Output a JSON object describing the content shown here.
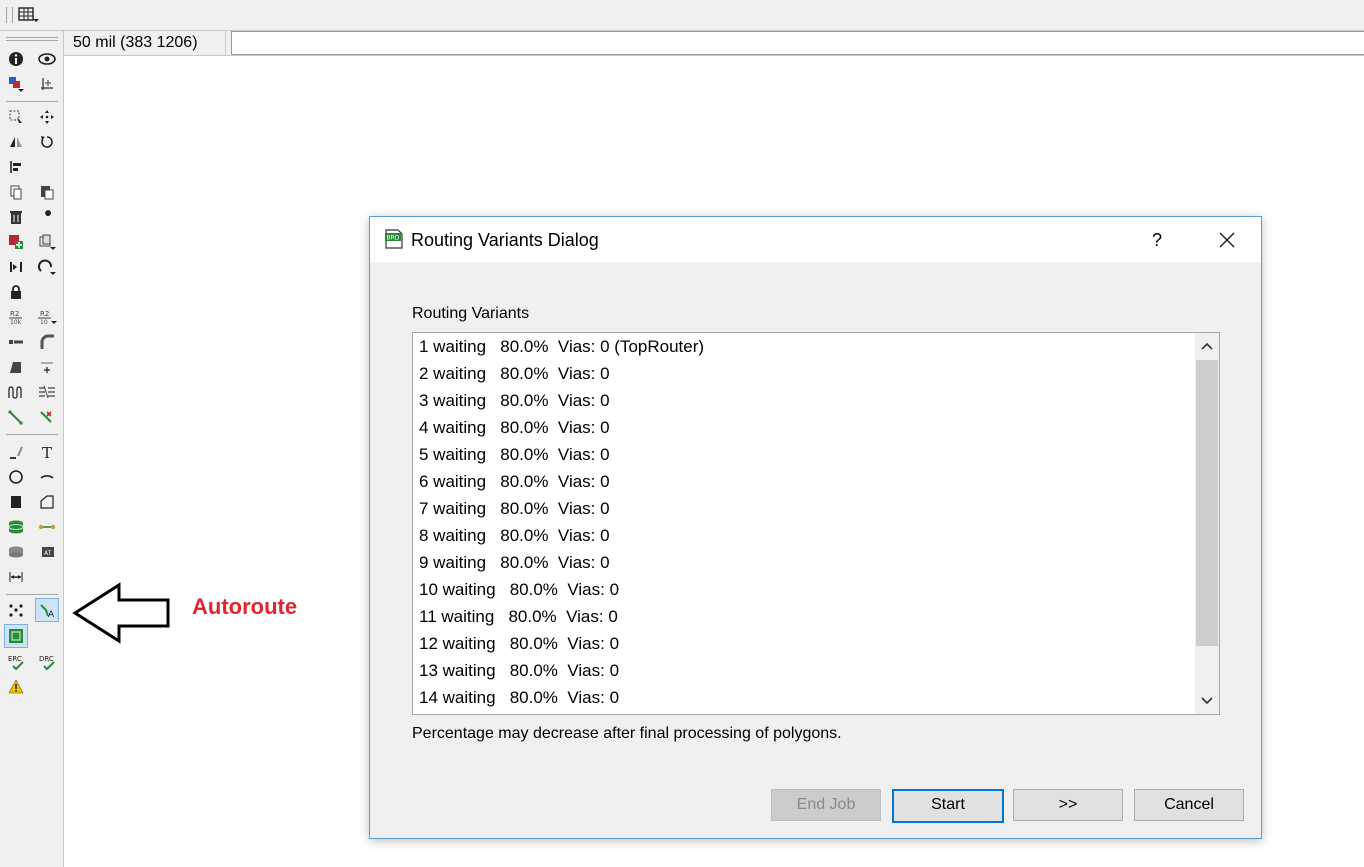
{
  "coordinate_display": "50 mil (383 1206)",
  "command_line": "",
  "callout": {
    "label": "Autoroute"
  },
  "dialog": {
    "title": "Routing Variants Dialog",
    "help_label": "?",
    "variants_label": "Routing Variants",
    "variants": [
      "1 waiting   80.0%  Vias: 0 (TopRouter)",
      "2 waiting   80.0%  Vias: 0",
      "3 waiting   80.0%  Vias: 0",
      "4 waiting   80.0%  Vias: 0",
      "5 waiting   80.0%  Vias: 0",
      "6 waiting   80.0%  Vias: 0",
      "7 waiting   80.0%  Vias: 0",
      "8 waiting   80.0%  Vias: 0",
      "9 waiting   80.0%  Vias: 0",
      "10 waiting   80.0%  Vias: 0",
      "11 waiting   80.0%  Vias: 0",
      "12 waiting   80.0%  Vias: 0",
      "13 waiting   80.0%  Vias: 0",
      "14 waiting   80.0%  Vias: 0"
    ],
    "note": "Percentage may decrease after final processing of polygons.",
    "buttons": {
      "end_job": "End Job",
      "start": "Start",
      "next": ">>",
      "cancel": "Cancel"
    }
  },
  "toolbar_icons": [
    "info-icon",
    "eye-icon",
    "layer-display-icon",
    "mark-icon",
    "group-icon",
    "move-icon",
    "mirror-icon",
    "rotate-icon",
    "align-icon",
    "copy-icon",
    "paste-icon",
    "delete-icon",
    "change-icon",
    "add-icon",
    "replace-icon",
    "swap-icon",
    "optimize-icon",
    "lock-icon",
    "name-icon",
    "value-icon",
    "split-icon",
    "miter-icon",
    "slice-icon",
    "origin-icon",
    "meander-icon",
    "lines-icon",
    "route-icon",
    "ripup-icon",
    "line-icon",
    "text-icon",
    "circle-icon",
    "arc-icon",
    "rectangle-icon",
    "polygon-icon",
    "via-icon",
    "signal-icon",
    "hole-icon",
    "attribute-icon",
    "dimension-icon",
    "ratsnest-icon",
    "autoroute-icon",
    "ratsnest-ex-icon",
    "erc-icon",
    "drc-icon",
    "errors-icon"
  ],
  "colors": {
    "callout_text": "#e0262e",
    "dialog_border": "#5b9bd5",
    "default_button_border": "#0078d7"
  }
}
